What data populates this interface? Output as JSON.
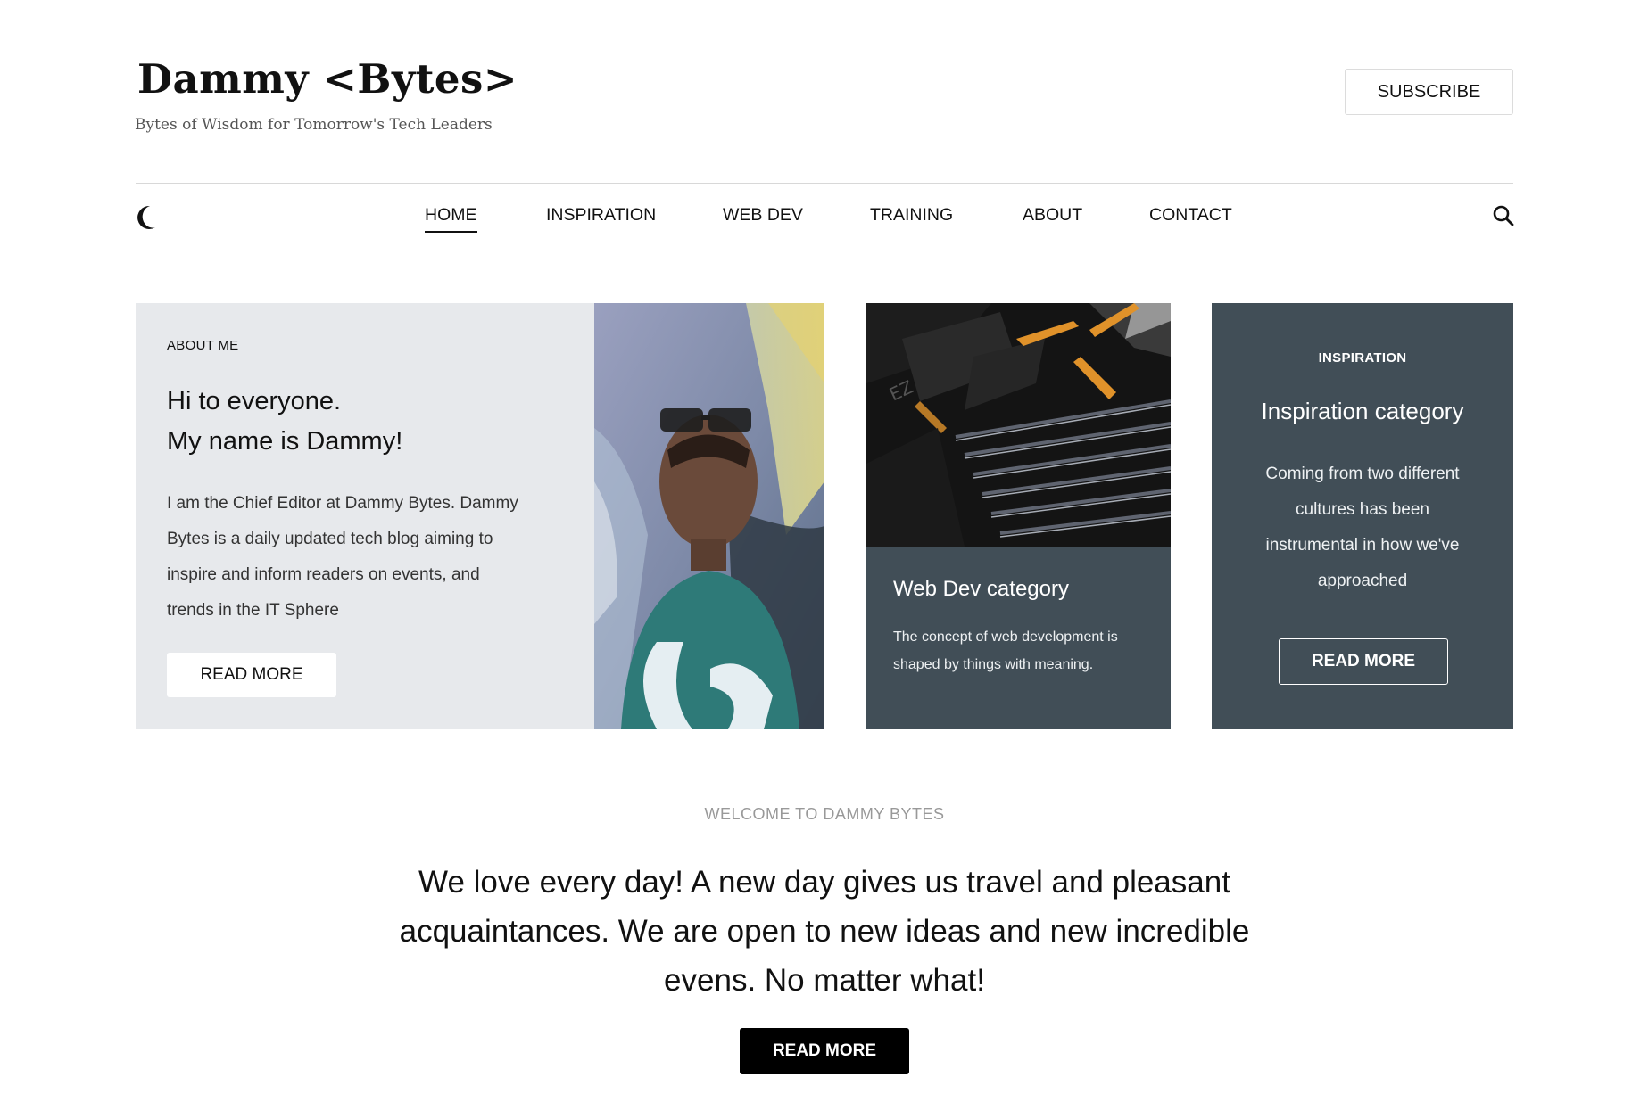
{
  "header": {
    "logo": "Dammy <Bytes>",
    "tagline": "Bytes of Wisdom for Tomorrow's Tech Leaders",
    "subscribe_label": "SUBSCRIBE"
  },
  "nav": {
    "items": [
      {
        "label": "HOME",
        "active": true
      },
      {
        "label": "INSPIRATION",
        "active": false
      },
      {
        "label": "WEB DEV",
        "active": false
      },
      {
        "label": "TRAINING",
        "active": false
      },
      {
        "label": "ABOUT",
        "active": false
      },
      {
        "label": "CONTACT",
        "active": false
      }
    ],
    "theme_toggle_icon": "moon-icon",
    "search_icon": "search-icon"
  },
  "about": {
    "eyebrow": "ABOUT ME",
    "title_line1": "Hi to everyone.",
    "title_line2": "My name is Dammy!",
    "text": "I am the Chief Editor at Dammy Bytes. Dammy Bytes is a daily updated tech blog aiming to inspire and inform readers on events, and trends in the IT Sphere",
    "button": "READ MORE"
  },
  "webdev": {
    "title": "Web Dev category",
    "text": "The concept of web development is shaped by things with meaning."
  },
  "inspiration": {
    "eyebrow": "INSPIRATION",
    "title": "Inspiration category",
    "text": "Coming from two different cultures has been instrumental in how we've approached",
    "button": "READ MORE"
  },
  "welcome": {
    "eyebrow": "WELCOME TO DAMMY BYTES",
    "heading": "We love every day! A new day gives us travel and pleasant acquaintances. We are open to new ideas and new incredible evens. No matter what!",
    "button": "READ MORE"
  },
  "colors": {
    "card_dark": "#414e57",
    "card_light": "#e7e9ec",
    "accent_orange": "#e0922a"
  }
}
